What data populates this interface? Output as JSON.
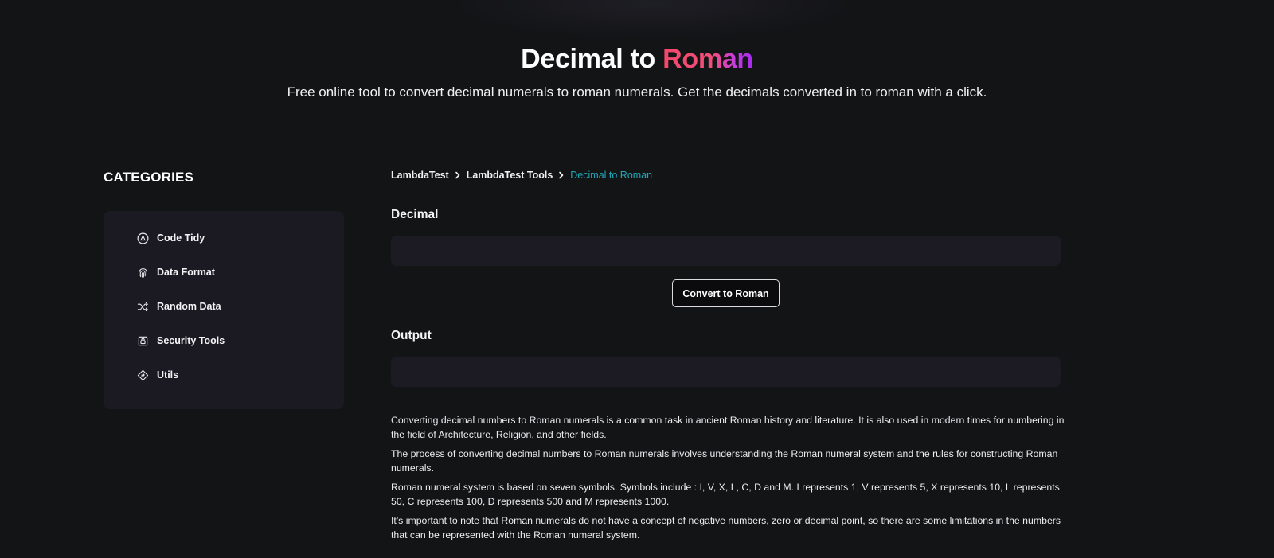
{
  "hero": {
    "title_main": "Decimal to ",
    "title_accent": "Roman",
    "subtitle": "Free online tool to convert decimal numerals to roman numerals. Get the decimals converted in to roman with a click."
  },
  "sidebar": {
    "heading": "CATEGORIES",
    "items": [
      {
        "label": "Code Tidy",
        "icon": "code-tidy-icon"
      },
      {
        "label": "Data Format",
        "icon": "fingerprint-icon"
      },
      {
        "label": "Random Data",
        "icon": "shuffle-icon"
      },
      {
        "label": "Security Tools",
        "icon": "lock-icon"
      },
      {
        "label": "Utils",
        "icon": "diamond-arrow-icon"
      }
    ]
  },
  "breadcrumb": {
    "items": [
      "LambdaTest",
      "LambdaTest Tools"
    ],
    "current": "Decimal to Roman"
  },
  "tool": {
    "input_label": "Decimal",
    "input_value": "",
    "button_label": "Convert to Roman",
    "output_label": "Output",
    "output_value": ""
  },
  "description": [
    "Converting decimal numbers to Roman numerals is a common task in ancient Roman history and literature. It is also used in modern times for numbering in the field of Architecture, Religion, and other fields.",
    "The process of converting decimal numbers to Roman numerals involves understanding the Roman numeral system and the rules for constructing Roman numerals.",
    "Roman numeral system is based on seven symbols. Symbols include : I, V, X, L, C, D and M. I represents 1, V represents 5, X represents 10, L represents 50, C represents 100, D represents 500 and M represents 1000.",
    "It's important to note that Roman numerals do not have a concept of negative numbers, zero or decimal point, so there are some limitations in the numbers that can be represented with the Roman numeral system."
  ],
  "colors": {
    "background": "#131416",
    "panel": "#1b1a23",
    "accent_teal": "#1fa8b8",
    "accent_gradient_start": "#f2486b",
    "accent_gradient_end": "#a62af0"
  }
}
